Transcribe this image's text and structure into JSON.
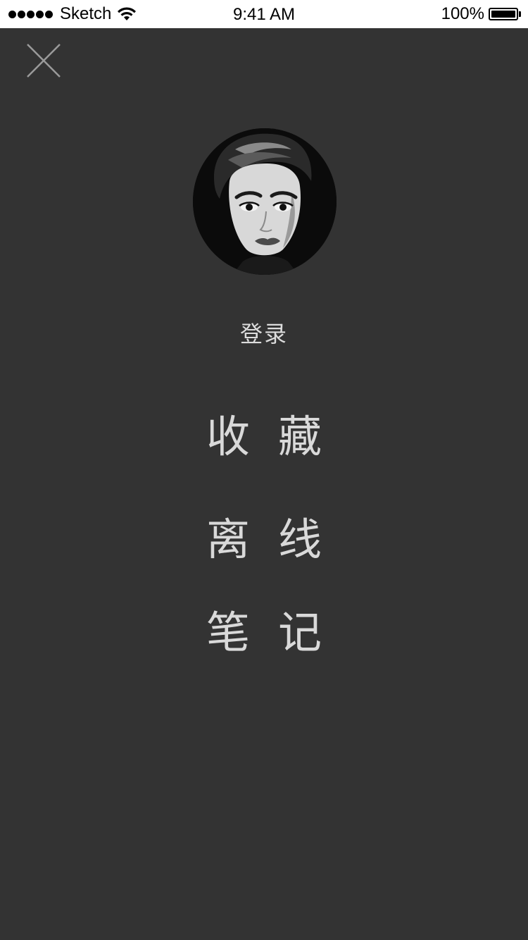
{
  "status_bar": {
    "carrier": "Sketch",
    "time": "9:41 AM",
    "battery": "100%",
    "signal_icon": "signal-dots-icon",
    "wifi_icon": "wifi-icon",
    "battery_icon": "battery-icon"
  },
  "header": {
    "close_icon": "close-icon"
  },
  "profile": {
    "avatar": "avatar",
    "login_label": "登录"
  },
  "menu": {
    "items": [
      {
        "label": "收藏"
      },
      {
        "label": "离线"
      },
      {
        "label": "笔记"
      }
    ]
  },
  "colors": {
    "background": "#333333",
    "text": "#d9d9d9",
    "status_bar_bg": "#ffffff"
  }
}
